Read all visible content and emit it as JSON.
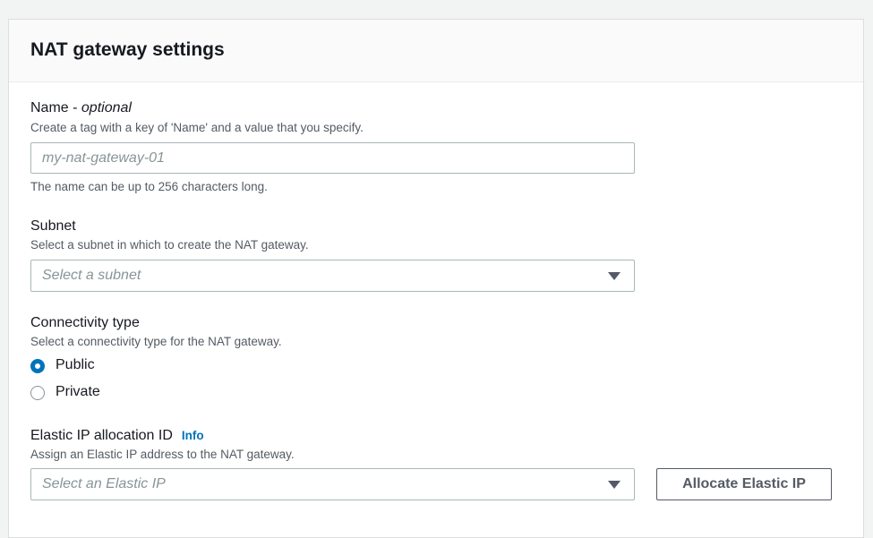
{
  "panel": {
    "title": "NAT gateway settings"
  },
  "name_field": {
    "label": "Name - ",
    "label_optional": "optional",
    "description": "Create a tag with a key of 'Name' and a value that you specify.",
    "value": "",
    "placeholder": "my-nat-gateway-01",
    "constraint": "The name can be up to 256 characters long."
  },
  "subnet_field": {
    "label": "Subnet",
    "description": "Select a subnet in which to create the NAT gateway.",
    "placeholder": "Select a subnet",
    "icon": "chevron-down-icon"
  },
  "connectivity_field": {
    "label": "Connectivity type",
    "description": "Select a connectivity type for the NAT gateway.",
    "options": [
      {
        "label": "Public",
        "selected": true
      },
      {
        "label": "Private",
        "selected": false
      }
    ]
  },
  "elastic_ip_field": {
    "label": "Elastic IP allocation ID",
    "info_link": "Info",
    "description": "Assign an Elastic IP address to the NAT gateway.",
    "placeholder": "Select an Elastic IP",
    "icon": "chevron-down-icon",
    "allocate_button": "Allocate Elastic IP"
  },
  "colors": {
    "accent": "#0073bb",
    "text": "#16191f",
    "secondary_text": "#545b64",
    "placeholder": "#879596",
    "border": "#aab7b8"
  }
}
